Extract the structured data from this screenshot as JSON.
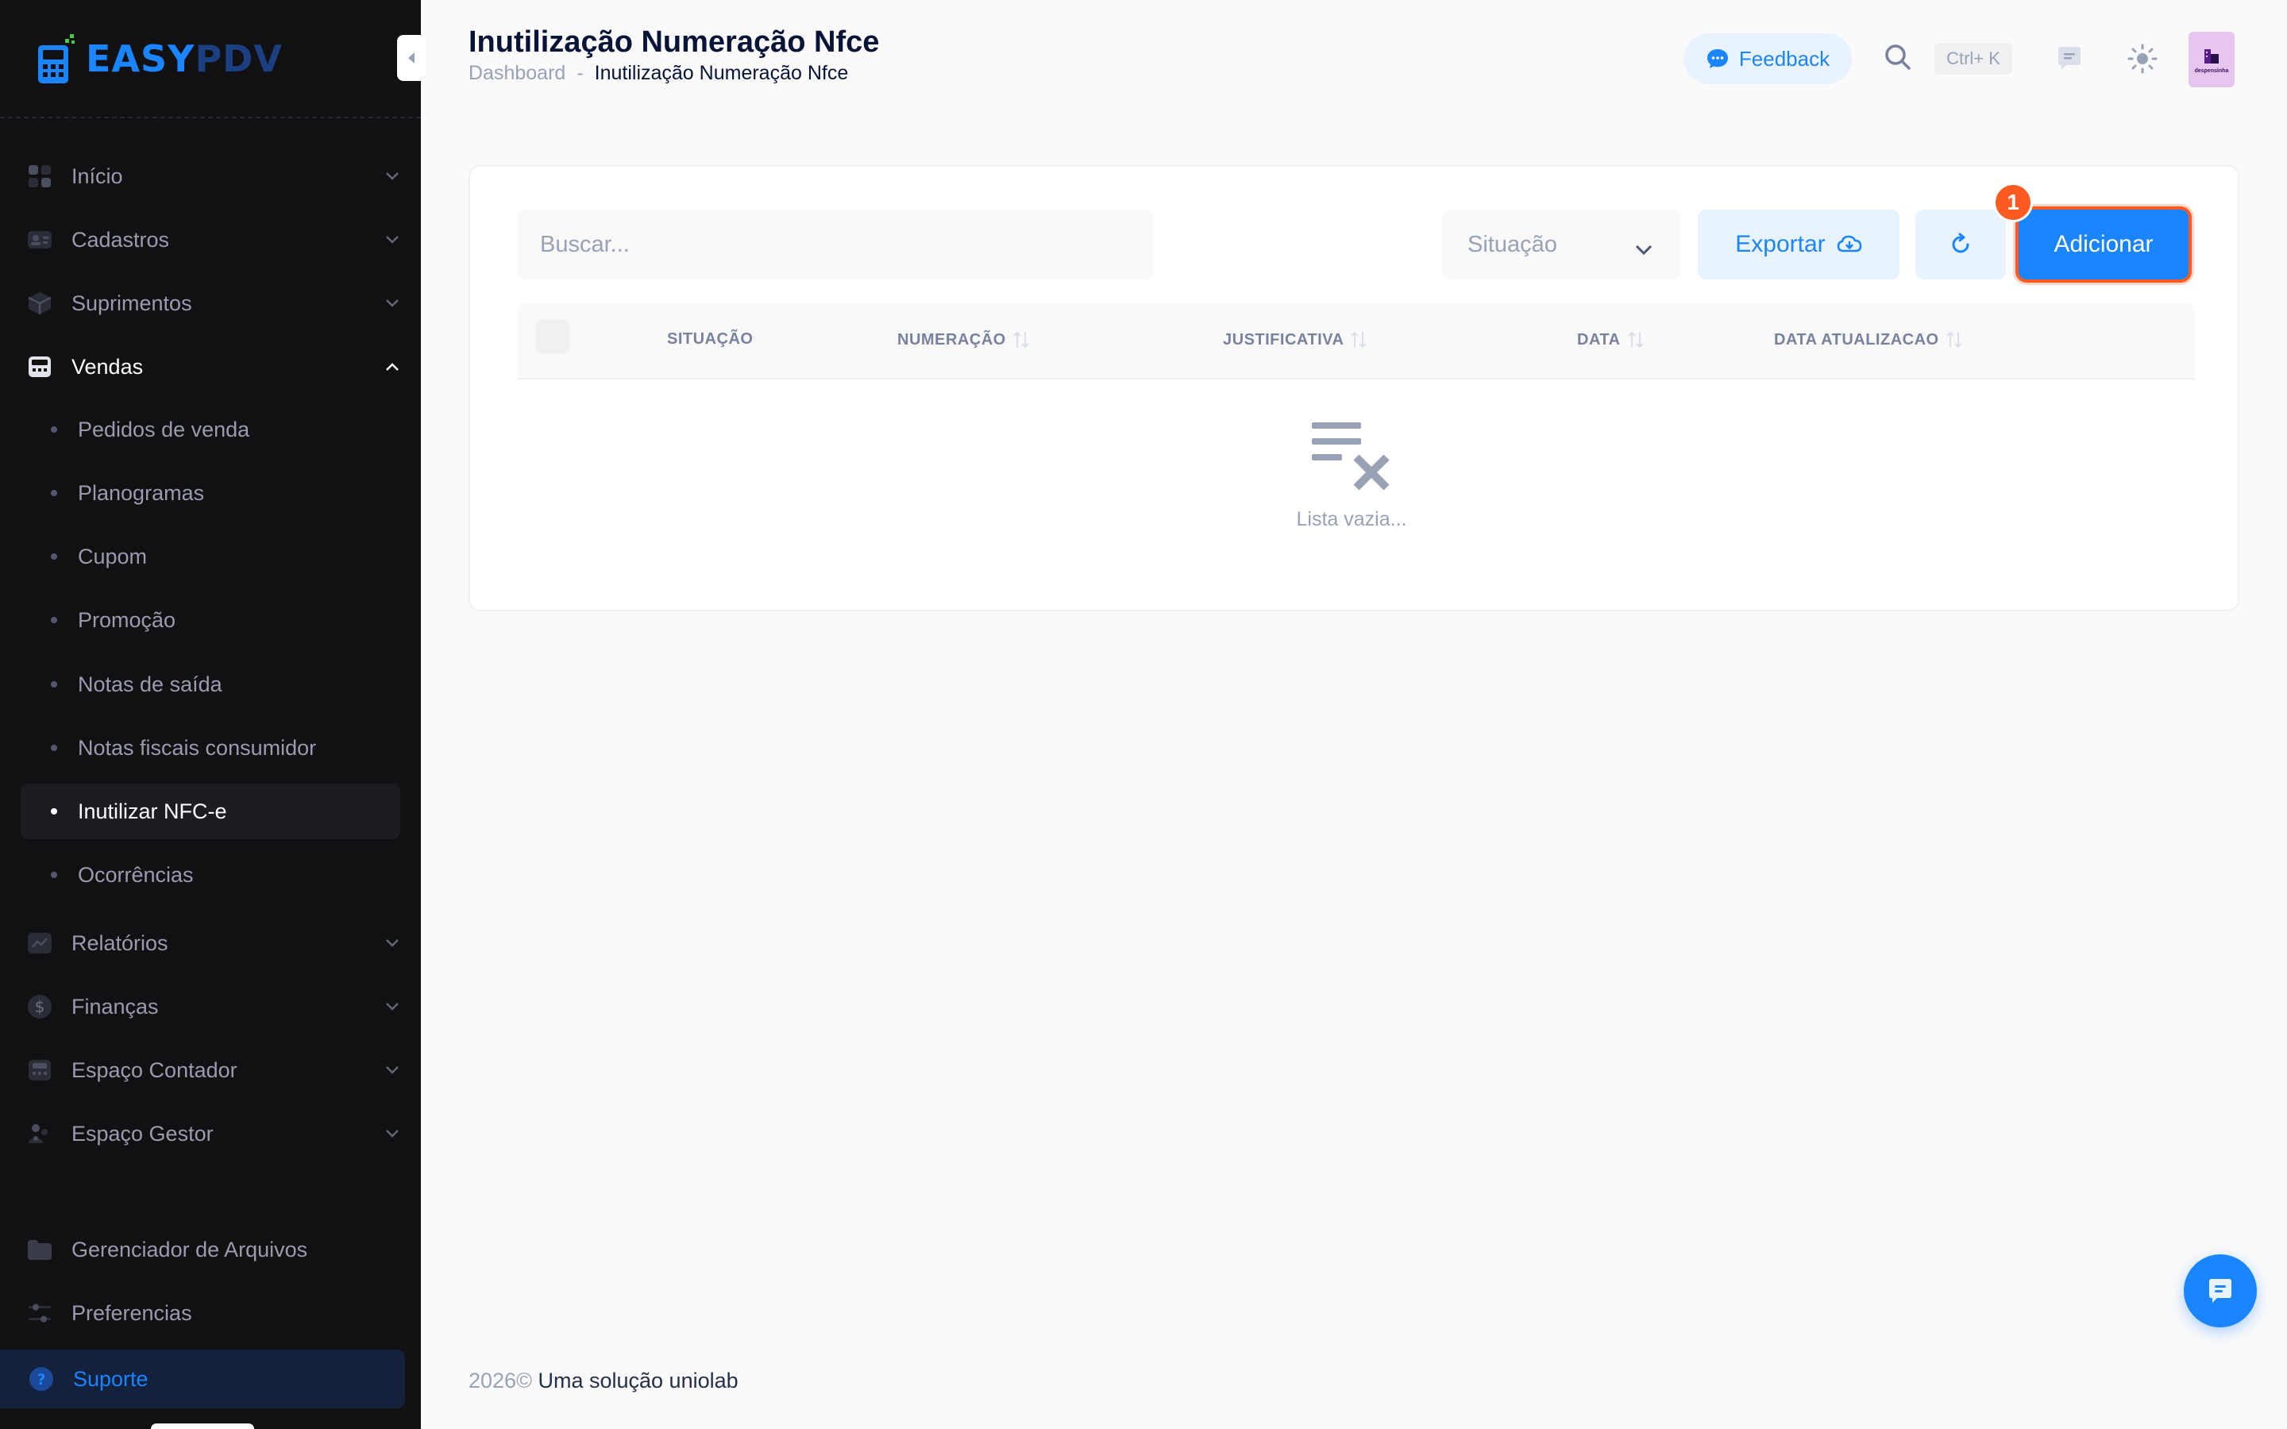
{
  "brand": {
    "logo_part1": "EASY",
    "logo_part2": "PDV",
    "accent": "#1b84ff"
  },
  "sidebar": {
    "items": [
      {
        "label": "Início",
        "icon": "grid-icon"
      },
      {
        "label": "Cadastros",
        "icon": "id-card-icon"
      },
      {
        "label": "Suprimentos",
        "icon": "box-icon"
      },
      {
        "label": "Vendas",
        "icon": "cash-register-icon",
        "expanded": true
      }
    ],
    "vendas_sub": [
      {
        "label": "Pedidos de venda"
      },
      {
        "label": "Planogramas"
      },
      {
        "label": "Cupom"
      },
      {
        "label": "Promoção"
      },
      {
        "label": "Notas de saída"
      },
      {
        "label": "Notas fiscais consumidor"
      },
      {
        "label": "Inutilizar NFC-e",
        "active": true
      },
      {
        "label": "Ocorrências"
      }
    ],
    "items2": [
      {
        "label": "Relatórios",
        "icon": "chart-icon"
      },
      {
        "label": "Finanças",
        "icon": "dollar-icon"
      },
      {
        "label": "Espaço Contador",
        "icon": "calculator-icon"
      },
      {
        "label": "Espaço Gestor",
        "icon": "people-icon"
      }
    ],
    "bottom": [
      {
        "label": "Gerenciador de Arquivos",
        "icon": "folder-icon"
      },
      {
        "label": "Preferencias",
        "icon": "sliders-icon"
      }
    ],
    "support": {
      "label": "Suporte",
      "icon": "question-icon"
    }
  },
  "header": {
    "title": "Inutilização Numeração Nfce",
    "breadcrumb": {
      "home": "Dashboard",
      "sep": "-",
      "current": "Inutilização Numeração Nfce"
    },
    "feedback_label": "Feedback",
    "search_shortcut": "Ctrl+ K",
    "avatar_text": "despensinha"
  },
  "toolbar": {
    "search_placeholder": "Buscar...",
    "status_select": "Situação",
    "export_label": "Exportar",
    "add_label": "Adicionar",
    "badge": "1"
  },
  "table": {
    "columns": [
      "SITUAÇÃO",
      "NUMERAÇÃO",
      "JUSTIFICATIVA",
      "DATA",
      "DATA ATUALIZACAO"
    ],
    "rows": [],
    "empty_text": "Lista vazia..."
  },
  "footer": {
    "year": "2026©",
    "company": "Uma solução uniolab"
  }
}
